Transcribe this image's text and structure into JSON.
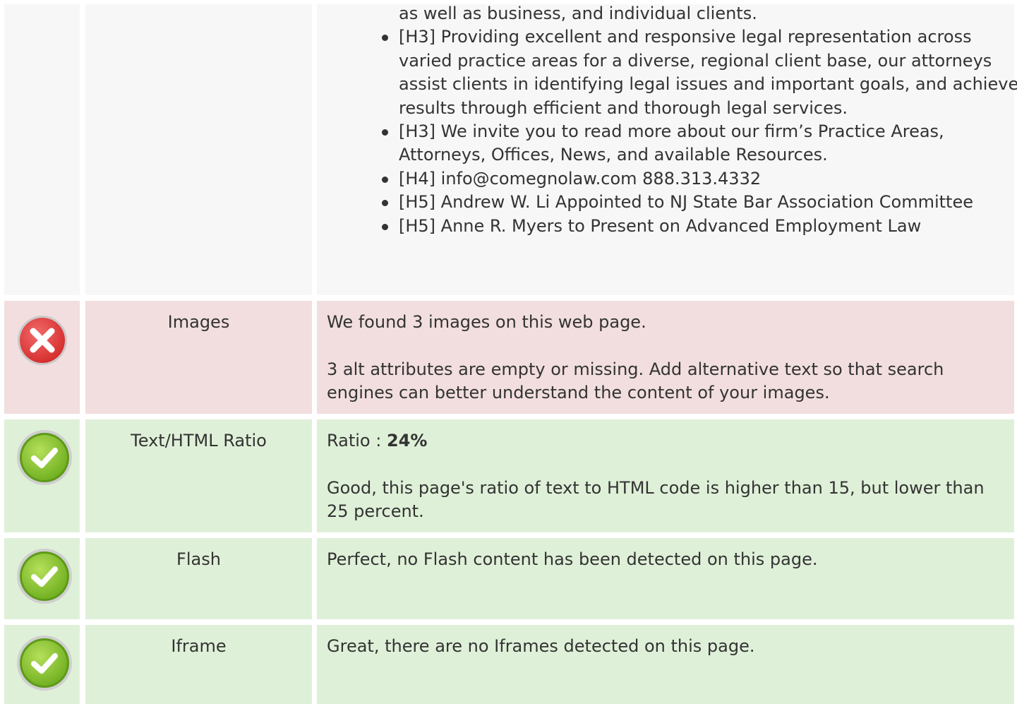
{
  "headings_row": {
    "items": [
      {
        "text": "as well as business, and individual clients.",
        "bullet": false
      },
      {
        "text": "[H3] Providing excellent and responsive legal representation across varied practice areas for a diverse, regional client base, our attorneys assist clients in identifying legal issues and important goals, and achieve results through efficient and thorough legal services.",
        "bullet": true
      },
      {
        "text": "[H3] We invite you to read more about our firm’s Practice Areas, Attorneys, Offices, News, and available Resources.",
        "bullet": true
      },
      {
        "text": "[H4] info@comegnolaw.com 888.313.4332",
        "bullet": true
      },
      {
        "text": "[H5] Andrew W. Li Appointed to NJ State Bar Association Committee",
        "bullet": true
      },
      {
        "text": "[H5] Anne R. Myers to Present on Advanced Employment Law",
        "bullet": true
      }
    ]
  },
  "checks": {
    "images": {
      "status": "error",
      "icon": "error-x-icon",
      "label": "Images",
      "line1": "We found 3 images on this web page.",
      "line2": "3 alt attributes are empty or missing. Add alternative text so that search engines can better understand the content of your images."
    },
    "ratio": {
      "status": "pass",
      "icon": "check-icon",
      "label": "Text/HTML Ratio",
      "ratio_prefix": "Ratio : ",
      "ratio_value": "24%",
      "line2": "Good, this page's ratio of text to HTML code is higher than 15, but lower than 25 percent."
    },
    "flash": {
      "status": "pass",
      "icon": "check-icon",
      "label": "Flash",
      "line1": "Perfect, no Flash content has been detected on this page."
    },
    "iframe": {
      "status": "pass",
      "icon": "check-icon",
      "label": "Iframe",
      "line1": "Great, there are no Iframes detected on this page."
    }
  },
  "colors": {
    "error_bg": "#f2dede",
    "pass_bg": "#dff0d8",
    "neutral_bg": "#f7f7f7",
    "error_icon": "#e23b3b",
    "pass_icon": "#8cc63f"
  }
}
